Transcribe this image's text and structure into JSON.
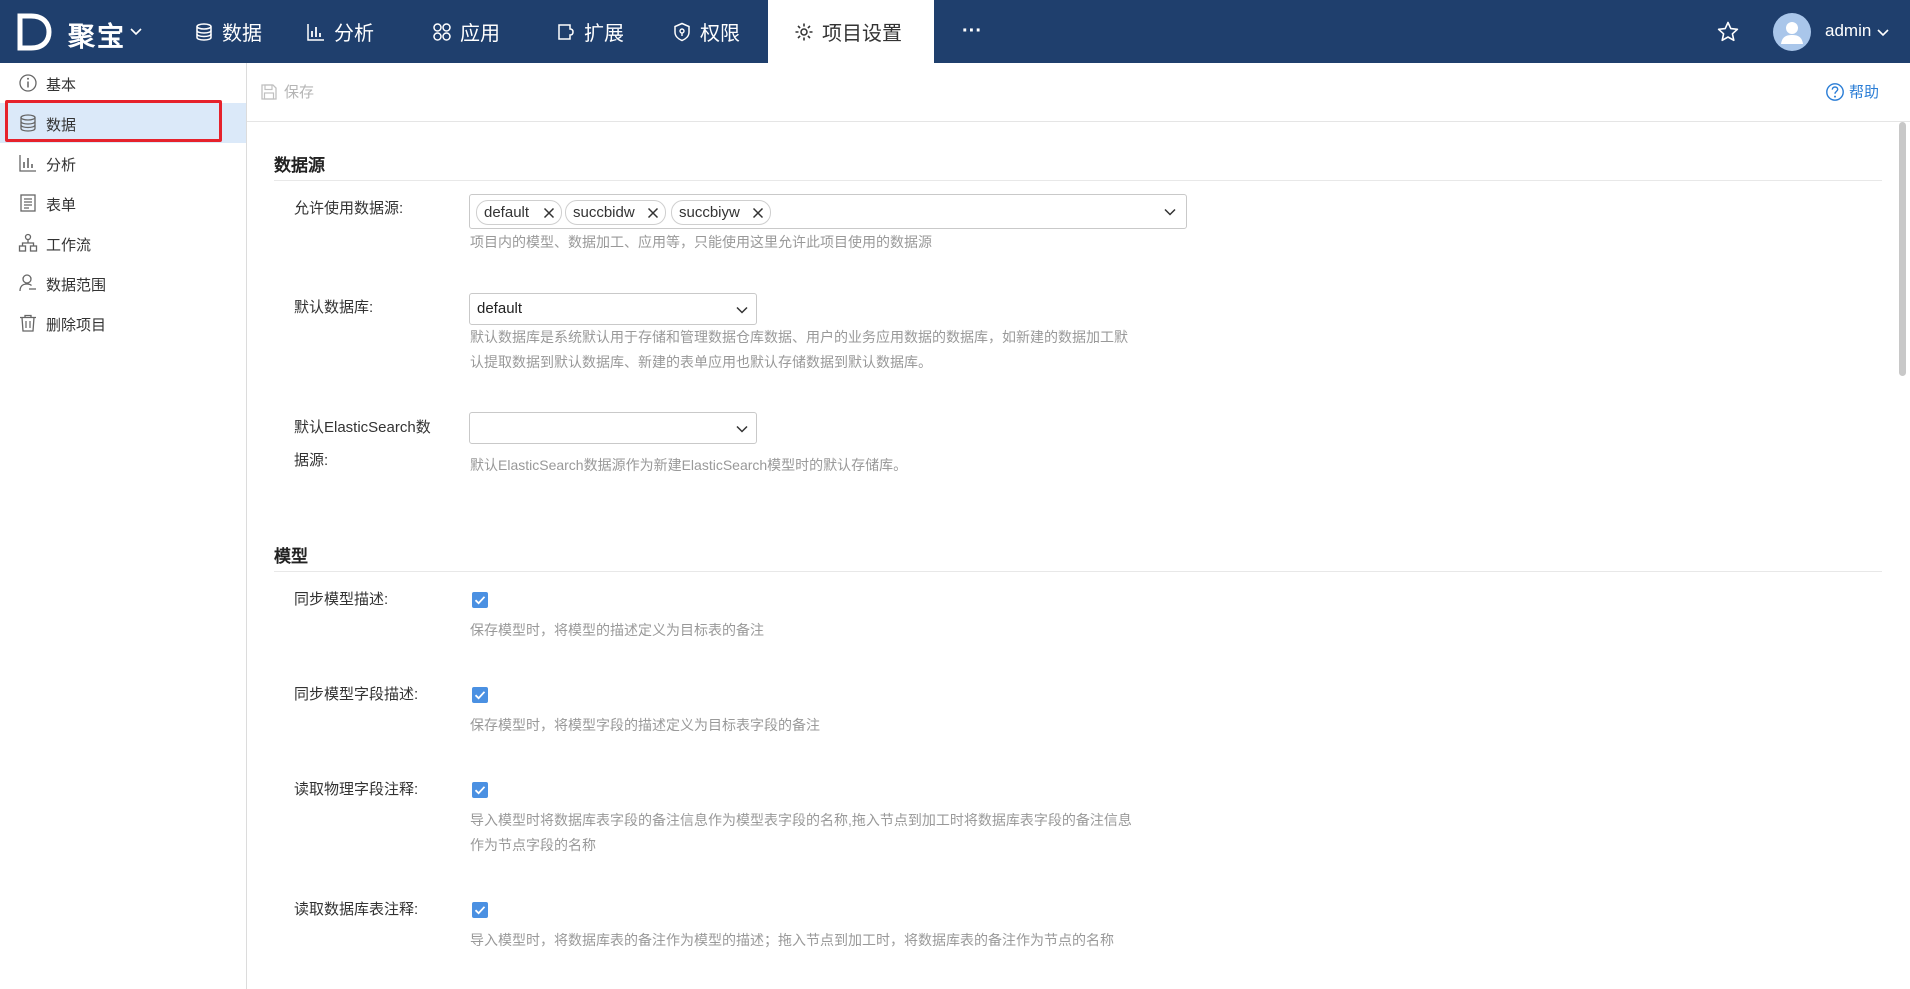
{
  "app": {
    "brand": "聚宝"
  },
  "nav": {
    "items": [
      {
        "label": "数据",
        "icon": "database-icon"
      },
      {
        "label": "分析",
        "icon": "bar-chart-icon"
      },
      {
        "label": "应用",
        "icon": "grid-icon"
      },
      {
        "label": "扩展",
        "icon": "extension-icon"
      },
      {
        "label": "权限",
        "icon": "shield-icon"
      },
      {
        "label": "项目设置",
        "icon": "gear-icon",
        "active": true
      }
    ],
    "more": "···",
    "user": "admin"
  },
  "sidebar": {
    "items": [
      {
        "label": "基本",
        "icon": "info-icon"
      },
      {
        "label": "数据",
        "icon": "database-icon",
        "active": true
      },
      {
        "label": "分析",
        "icon": "bar-chart-icon"
      },
      {
        "label": "表单",
        "icon": "form-icon"
      },
      {
        "label": "工作流",
        "icon": "workflow-icon"
      },
      {
        "label": "数据范围",
        "icon": "user-scope-icon"
      },
      {
        "label": "删除项目",
        "icon": "trash-icon"
      }
    ]
  },
  "toolbar": {
    "save_label": "保存",
    "help_label": "帮助"
  },
  "datasource": {
    "title": "数据源",
    "allowed_label": "允许使用数据源:",
    "allowed_tags": [
      "default",
      "succbidw",
      "succbiyw"
    ],
    "allowed_help": "项目内的模型、数据加工、应用等，只能使用这里允许此项目使用的数据源",
    "default_db_label": "默认数据库:",
    "default_db_value": "default",
    "default_db_help_1": "默认数据库是系统默认用于存储和管理数据仓库数据、用户的业务应用数据的数据库，如新建的数据加工默",
    "default_db_help_2": "认提取数据到默认数据库、新建的表单应用也默认存储数据到默认数据库。",
    "es_label_1": "默认ElasticSearch数",
    "es_label_2": "据源:",
    "es_value": "",
    "es_help": "默认ElasticSearch数据源作为新建ElasticSearch模型时的默认存储库。"
  },
  "model": {
    "title": "模型",
    "sync_desc_label": "同步模型描述:",
    "sync_desc_checked": true,
    "sync_desc_help": "保存模型时，将模型的描述定义为目标表的备注",
    "sync_field_label": "同步模型字段描述:",
    "sync_field_checked": true,
    "sync_field_help": "保存模型时，将模型字段的描述定义为目标表字段的备注",
    "read_phys_label": "读取物理字段注释:",
    "read_phys_checked": true,
    "read_phys_help_1": "导入模型时将数据库表字段的备注信息作为模型表字段的名称,拖入节点到加工时将数据库表字段的备注信息",
    "read_phys_help_2": "作为节点字段的名称",
    "read_table_label": "读取数据库表注释:",
    "read_table_checked": true,
    "read_table_help": "导入模型时，将数据库表的备注作为模型的描述；拖入节点到加工时，将数据库表的备注作为节点的名称"
  },
  "colors": {
    "topbar": "#1f3f6d",
    "accent": "#4a90e2",
    "highlight": "#e6222c",
    "active_bg": "#dbe9f9"
  }
}
